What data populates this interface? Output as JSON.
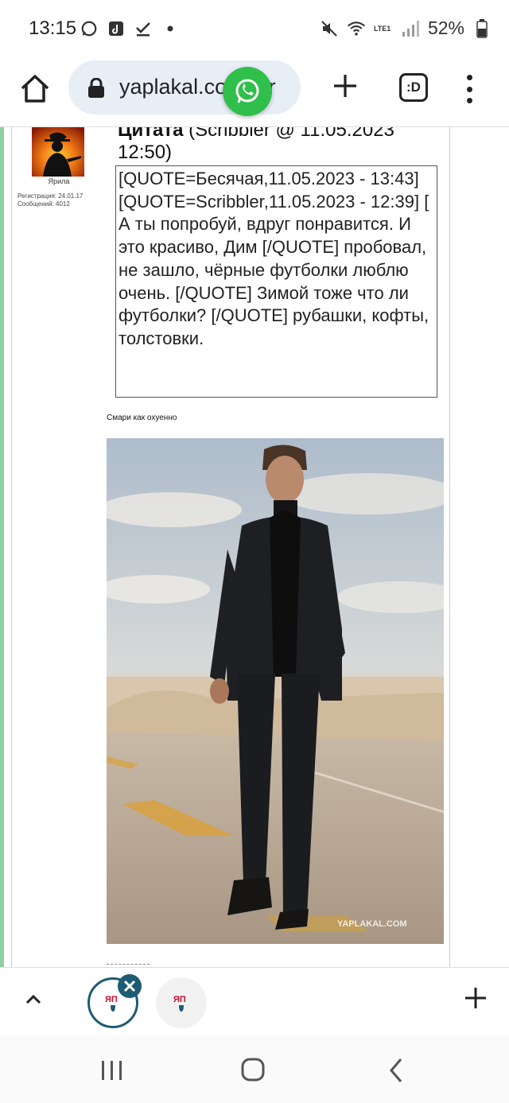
{
  "status_bar": {
    "time": "13:15",
    "battery": "52%",
    "network_label": "LTE1",
    "icons": [
      "whatsapp-icon",
      "tiktok-icon",
      "check-icon",
      "dot-icon",
      "mute-icon",
      "wifi-icon",
      "signal-icon",
      "battery-icon"
    ]
  },
  "browser": {
    "url": "yaplakal.com/for",
    "tabs_label": ":D",
    "accent": "#1d5c73"
  },
  "post": {
    "user": {
      "name": "Ярила",
      "registration": "Регистрация: 24.01.17",
      "messages": "Сообщений: 4012"
    },
    "quote_head_bold": "Цитата",
    "quote_head_rest": " (Scribbler @ 11.05.2023 12:50)",
    "quote_body": "[QUOTE=Бесячая,11.05.2023 - 13:43] [QUOTE=Scribbler,11.05.2023 - 12:39] [ А ты попробуй, вдруг понравится. И это красиво, Дим [/QUOTE] пробовал, не зашло, чёрные футболки люблю очень. [/QUOTE] Зимой тоже что ли футболки? [/QUOTE] рубашки, кофты, толстовки.",
    "message": "Смари как охуенно",
    "photo_watermark": "YAPLAKAL.COM"
  },
  "bottom_tabs": {
    "tab_logo": "ЯП",
    "icons": [
      "chevron-up-icon",
      "close-icon",
      "plus-icon"
    ]
  },
  "nav_bar": {
    "icons": [
      "recent-apps-icon",
      "home-icon",
      "back-icon"
    ]
  }
}
